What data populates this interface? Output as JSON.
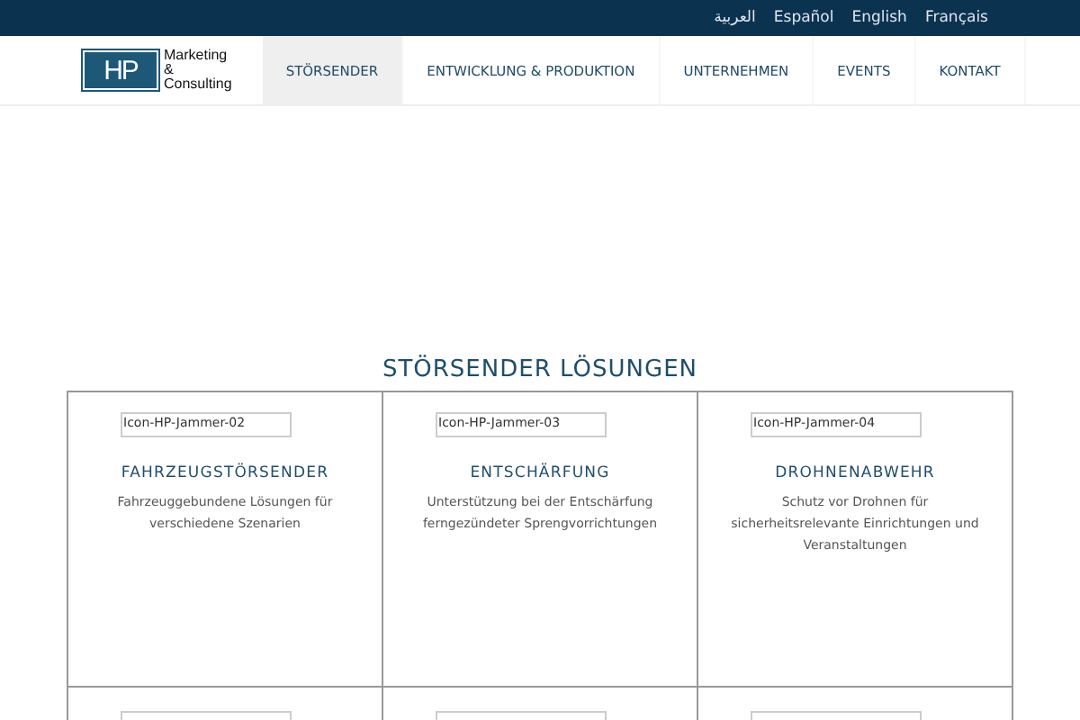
{
  "languages": [
    {
      "label": "العربية",
      "selected": false
    },
    {
      "label": "Español",
      "selected": false
    },
    {
      "label": "English",
      "selected": false
    },
    {
      "label": "Français",
      "selected": false
    }
  ],
  "logo": {
    "mark": "HP",
    "lines": [
      "Marketing",
      "&",
      "Consulting"
    ]
  },
  "nav": [
    {
      "label": "STÖRSENDER",
      "selected": true
    },
    {
      "label": "ENTWICKLUNG & PRODUKTION",
      "selected": false
    },
    {
      "label": "UNTERNEHMEN",
      "selected": false
    },
    {
      "label": "EVENTS",
      "selected": false
    },
    {
      "label": "KONTAKT",
      "selected": false
    }
  ],
  "heading": "STÖRSENDER LÖSUNGEN",
  "cards": [
    {
      "kind": "full",
      "image_alt": "Icon-HP-Jammer-02",
      "title": "FAHRZEUGSTÖRSENDER",
      "description": "Fahrzeuggebundene Lösungen für verschiedene Szenarien"
    },
    {
      "kind": "full",
      "image_alt": "Icon-HP-Jammer-03",
      "title": "ENTSCHÄRFUNG",
      "description": "Unterstützung bei der Entschärfung ferngezündeter Sprengvorrichtungen"
    },
    {
      "kind": "full",
      "image_alt": "Icon-HP-Jammer-04",
      "title": "DROHNENABWEHR",
      "description": "Schutz vor Drohnen für sicherheitsrelevante Einrichtungen und Veranstaltungen"
    },
    {
      "kind": "cut"
    },
    {
      "kind": "cut"
    },
    {
      "kind": "cut"
    }
  ]
}
